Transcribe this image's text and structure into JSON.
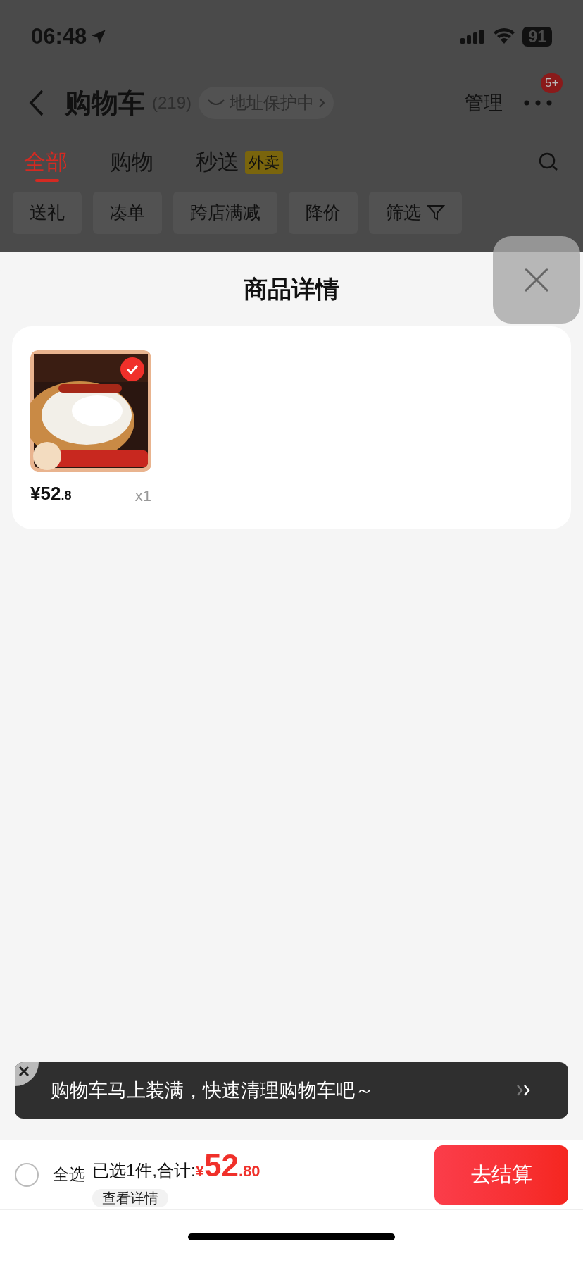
{
  "status_bar": {
    "time": "06:48",
    "battery": "91"
  },
  "header": {
    "title": "购物车",
    "count": "(219)",
    "address_badge": "地址保护中",
    "manage": "管理",
    "more_badge": "5+"
  },
  "tabs": [
    {
      "label": "全部",
      "selected": true
    },
    {
      "label": "购物",
      "selected": false
    },
    {
      "label": "秒送",
      "tag": "外卖",
      "selected": false
    }
  ],
  "filters": [
    {
      "label": "送礼",
      "kind": "plain"
    },
    {
      "label": "凑单",
      "kind": "plain"
    },
    {
      "label": "跨店满减",
      "kind": "plain"
    },
    {
      "label": "降价",
      "kind": "plain"
    },
    {
      "label": "筛选",
      "kind": "filter"
    }
  ],
  "sheet": {
    "title": "商品详情",
    "items": [
      {
        "kind": "picture",
        "price": "¥52",
        "price_decimal": ".8",
        "quantity": "x1",
        "selected": true
      }
    ]
  },
  "toast": {
    "text": "购物车马上装满，快速清理购物车吧～"
  },
  "footer": {
    "select_all": {
      "label": "全选",
      "checked": false
    },
    "summary": "已选1件,合计:",
    "currency": "¥",
    "total": "52",
    "total_decimal": ".80",
    "details": "查看详情",
    "checkout": "去结算"
  }
}
